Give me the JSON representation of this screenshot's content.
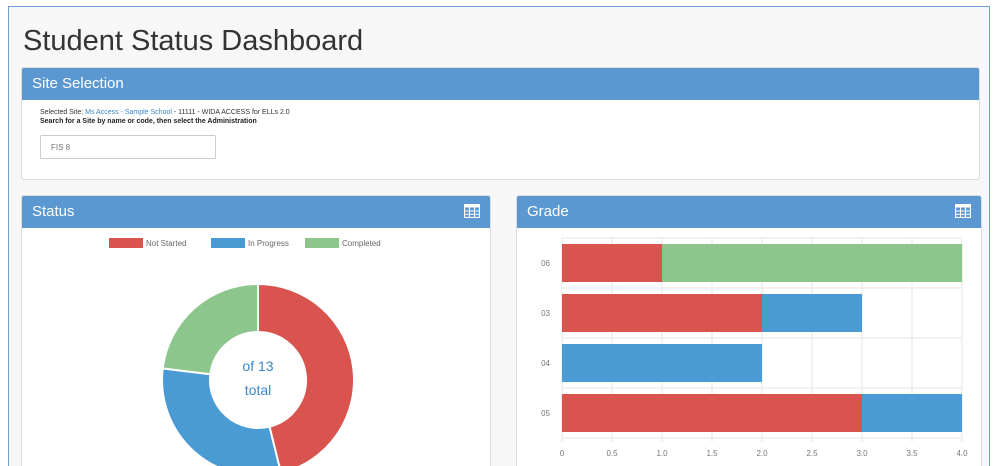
{
  "page": {
    "title": "Student Status Dashboard"
  },
  "site_selection": {
    "header": "Site Selection",
    "selected_label": "Selected Site:",
    "selected_link": "Ms Access - Sample School",
    "selected_rest": "- 11111 - WIDA ACCESS for ELLs 2.0",
    "instructions": "Search for a Site by name or code, then select the Administration",
    "search_placeholder": "FIS 8"
  },
  "status": {
    "header": "Status",
    "legend": [
      {
        "label": "Not Started",
        "color": "#d9534f"
      },
      {
        "label": "In Progress",
        "color": "#4a9bd4"
      },
      {
        "label": "Completed",
        "color": "#8cc68c"
      }
    ],
    "center_line1": "of 13",
    "center_line2": "total",
    "values": [
      6,
      4,
      3
    ],
    "center_color": "#3a87c8"
  },
  "grade": {
    "header": "Grade",
    "x_ticks": [
      "0",
      "0.5",
      "1.0",
      "1.5",
      "2.0",
      "2.5",
      "3.0",
      "3.5",
      "4.0"
    ],
    "rows": [
      {
        "label": "06",
        "segments": [
          {
            "value": 1,
            "color": "#d9534f"
          },
          {
            "value": 3,
            "color": "#8cc68c"
          }
        ]
      },
      {
        "label": "03",
        "segments": [
          {
            "value": 2,
            "color": "#d9534f"
          },
          {
            "value": 1,
            "color": "#4a9bd4"
          }
        ]
      },
      {
        "label": "04",
        "segments": [
          {
            "value": 2,
            "color": "#4a9bd4"
          }
        ]
      },
      {
        "label": "05",
        "segments": [
          {
            "value": 3,
            "color": "#d9534f"
          },
          {
            "value": 1,
            "color": "#4a9bd4"
          }
        ]
      }
    ],
    "x_max": 4
  },
  "chart_data": [
    {
      "type": "pie",
      "labels": [
        "Not Started",
        "In Progress",
        "Completed"
      ],
      "values": [
        6,
        4,
        3
      ],
      "annotations": [
        "of 13",
        "total"
      ]
    },
    {
      "type": "bar",
      "orientation": "horizontal",
      "stacked": true,
      "categories": [
        "06",
        "03",
        "04",
        "05"
      ],
      "series": [
        {
          "name": "Not Started",
          "values": [
            1,
            2,
            0,
            3
          ]
        },
        {
          "name": "In Progress",
          "values": [
            0,
            1,
            2,
            1
          ]
        },
        {
          "name": "Completed",
          "values": [
            3,
            0,
            0,
            0
          ]
        }
      ],
      "xlim": [
        0,
        4
      ],
      "grid": true
    }
  ]
}
